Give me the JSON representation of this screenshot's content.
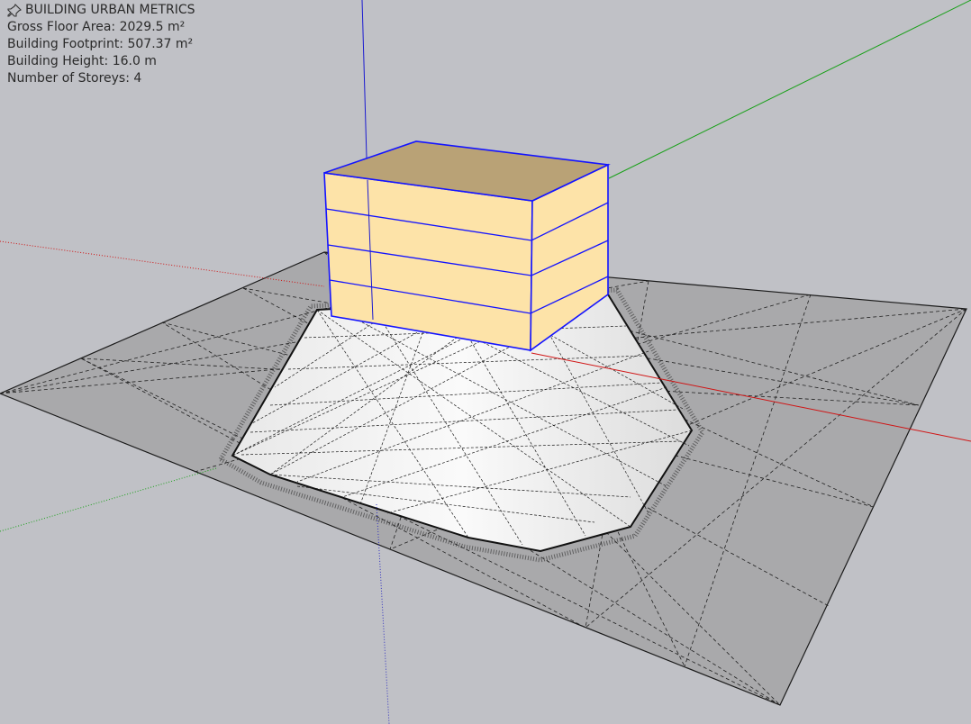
{
  "metrics_panel": {
    "icon": "pin-icon",
    "title": "BUILDING URBAN METRICS",
    "gross_floor_area": "Gross Floor Area: 2029.5 m²",
    "building_footprint": "Building Footprint: 507.37 m²",
    "building_height": "Building Height: 16.0 m",
    "number_of_storeys": "Number of Storeys: 4"
  },
  "colors": {
    "background": "#c0c1c6",
    "ground_plane": "#a8a8aa",
    "terrain_mound": "#f4f4f4",
    "building_side": "#fde3a8",
    "building_top": "#b9a276",
    "selection_edges": "#1414ff",
    "axis_red": "#d01010",
    "axis_green": "#10a010",
    "axis_blue": "#1010d0"
  }
}
